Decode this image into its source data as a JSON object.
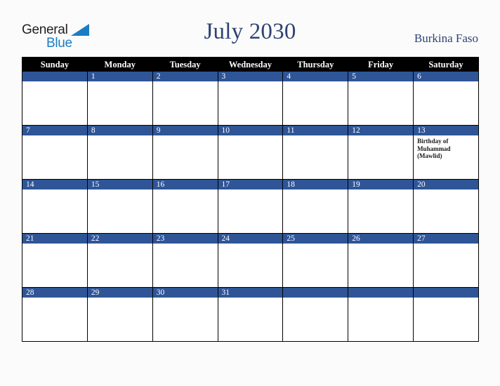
{
  "brand": {
    "name_part1": "General",
    "name_part2": "Blue",
    "triangle_color": "#1a7dc4",
    "text_color_part1": "#231f20",
    "text_color_part2": "#1a7dc4"
  },
  "header": {
    "title": "July 2030",
    "month": "July",
    "year": "2030",
    "country": "Burkina Faso",
    "title_color": "#2e4372"
  },
  "calendar": {
    "header_background": "#000000",
    "date_band_color": "#2f5597",
    "cell_background": "#ffffff",
    "grid_line_color": "#000000",
    "weekday_headers": [
      "Sunday",
      "Monday",
      "Tuesday",
      "Wednesday",
      "Thursday",
      "Friday",
      "Saturday"
    ],
    "weeks": [
      [
        {
          "day": "",
          "events": []
        },
        {
          "day": "1",
          "events": []
        },
        {
          "day": "2",
          "events": []
        },
        {
          "day": "3",
          "events": []
        },
        {
          "day": "4",
          "events": []
        },
        {
          "day": "5",
          "events": []
        },
        {
          "day": "6",
          "events": []
        }
      ],
      [
        {
          "day": "7",
          "events": []
        },
        {
          "day": "8",
          "events": []
        },
        {
          "day": "9",
          "events": []
        },
        {
          "day": "10",
          "events": []
        },
        {
          "day": "11",
          "events": []
        },
        {
          "day": "12",
          "events": []
        },
        {
          "day": "13",
          "events": [
            "Birthday of Muhammad (Mawlid)"
          ]
        }
      ],
      [
        {
          "day": "14",
          "events": []
        },
        {
          "day": "15",
          "events": []
        },
        {
          "day": "16",
          "events": []
        },
        {
          "day": "17",
          "events": []
        },
        {
          "day": "18",
          "events": []
        },
        {
          "day": "19",
          "events": []
        },
        {
          "day": "20",
          "events": []
        }
      ],
      [
        {
          "day": "21",
          "events": []
        },
        {
          "day": "22",
          "events": []
        },
        {
          "day": "23",
          "events": []
        },
        {
          "day": "24",
          "events": []
        },
        {
          "day": "25",
          "events": []
        },
        {
          "day": "26",
          "events": []
        },
        {
          "day": "27",
          "events": []
        }
      ],
      [
        {
          "day": "28",
          "events": []
        },
        {
          "day": "29",
          "events": []
        },
        {
          "day": "30",
          "events": []
        },
        {
          "day": "31",
          "events": []
        },
        {
          "day": "",
          "events": []
        },
        {
          "day": "",
          "events": []
        },
        {
          "day": "",
          "events": []
        }
      ]
    ]
  }
}
